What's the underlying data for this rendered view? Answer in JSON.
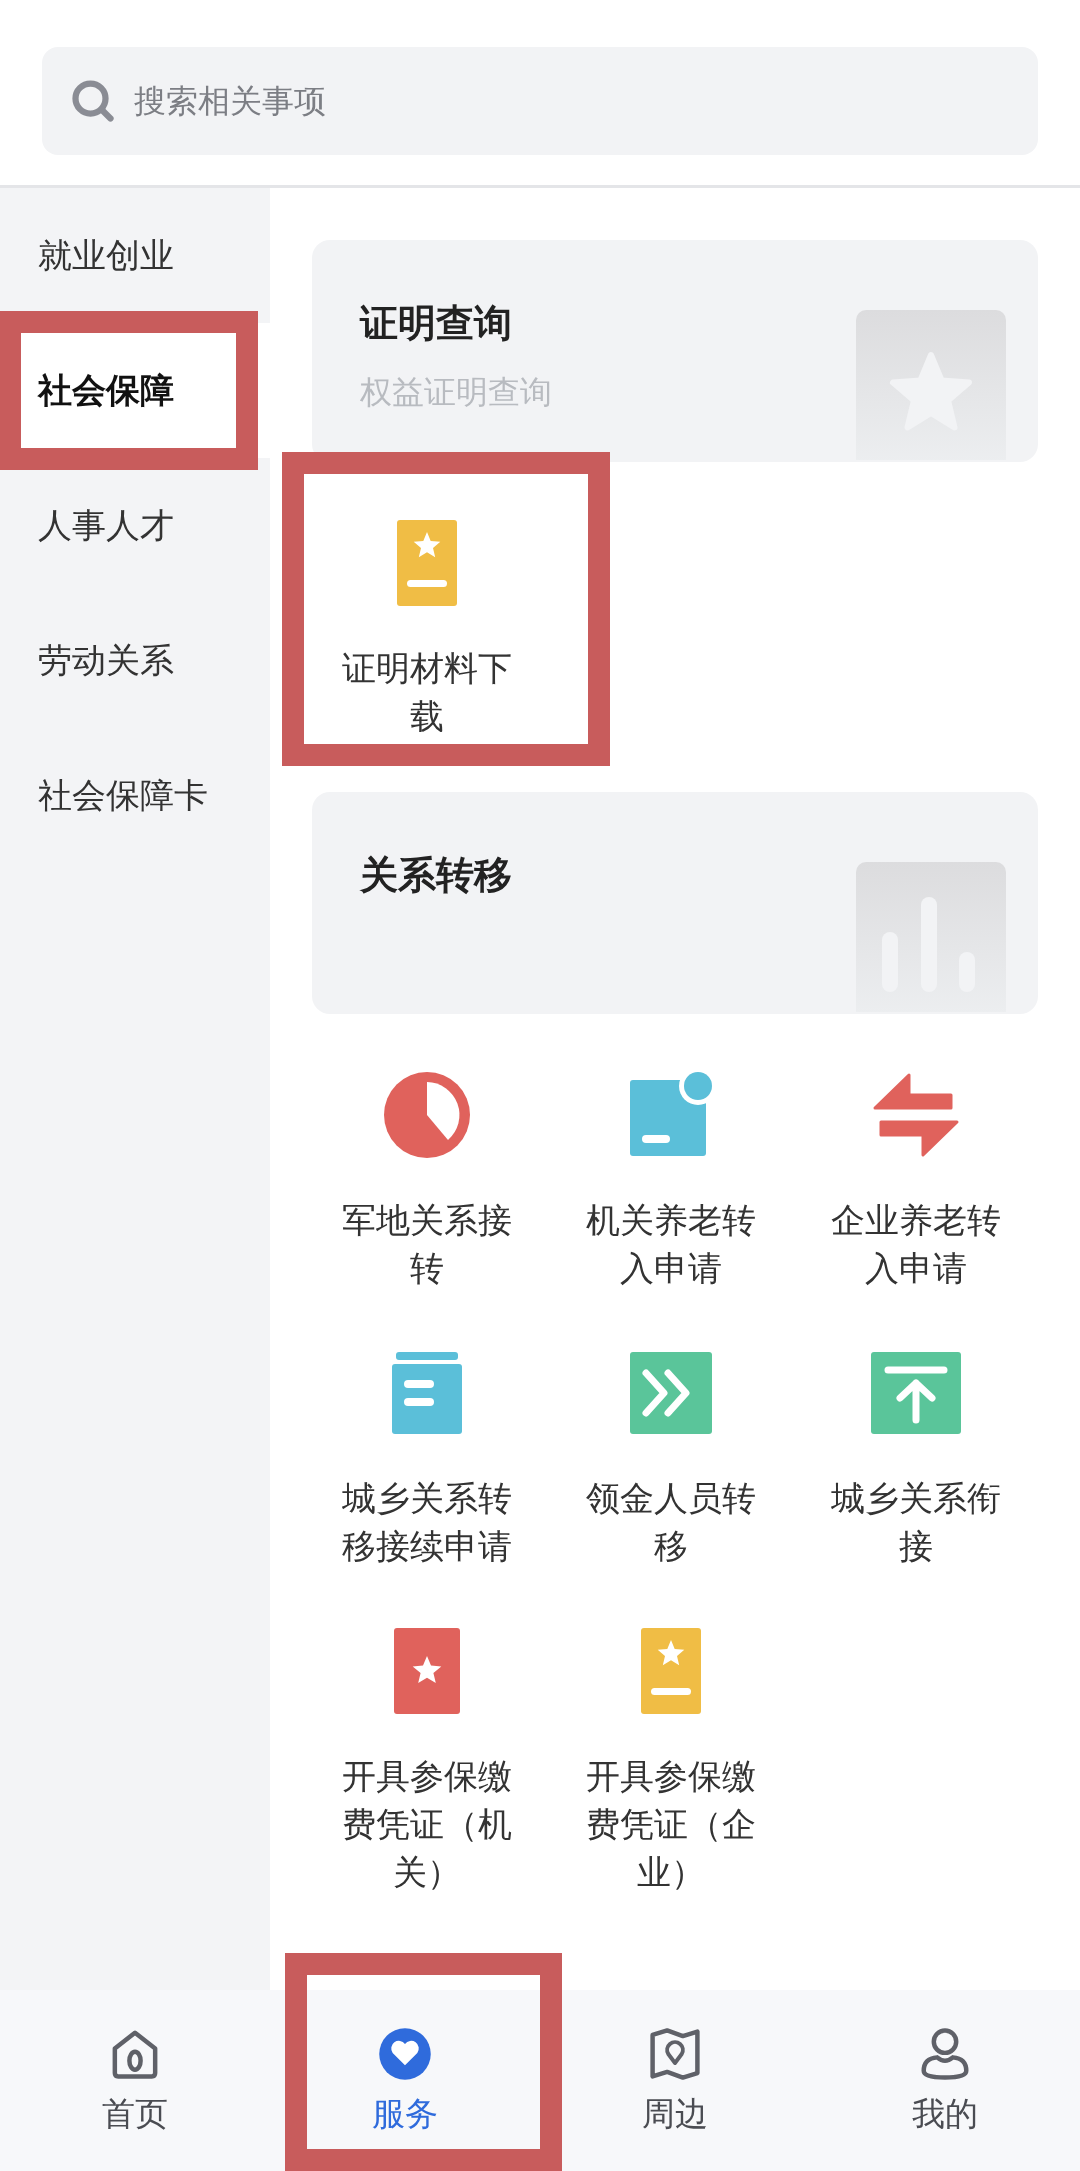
{
  "search": {
    "placeholder": "搜索相关事项"
  },
  "sidebar": {
    "items": [
      {
        "label": "就业创业",
        "selected": false,
        "highlighted": false
      },
      {
        "label": "社会保障",
        "selected": true,
        "highlighted": true
      },
      {
        "label": "人事人才",
        "selected": false,
        "highlighted": false
      },
      {
        "label": "劳动关系",
        "selected": false,
        "highlighted": false
      },
      {
        "label": "社会保障卡",
        "selected": false,
        "highlighted": false
      }
    ]
  },
  "sections": [
    {
      "title": "证明查询",
      "subtitle": "权益证明查询",
      "kind": "star",
      "items": [
        {
          "label": "证明材料下载",
          "kind": "star-card-bar",
          "color": "#f0bd45",
          "highlighted": true
        }
      ]
    },
    {
      "title": "关系转移",
      "kind": "bars",
      "items": [
        {
          "label": "军地关系接转",
          "kind": "pie",
          "color": "#e0625c",
          "highlighted": false
        },
        {
          "label": "机关养老转入申请",
          "kind": "dot-card",
          "color": "#5bbfd9",
          "highlighted": false
        },
        {
          "label": "企业养老转入申请",
          "kind": "swap",
          "color": "#e0625c",
          "highlighted": false
        },
        {
          "label": "城乡关系转移接续申请",
          "kind": "doc",
          "color": "#5bbfd9",
          "highlighted": false
        },
        {
          "label": "领金人员转移",
          "kind": "chevrons",
          "color": "#5ac59a",
          "highlighted": false
        },
        {
          "label": "城乡关系衔接",
          "kind": "top-arrow",
          "color": "#5ac59a",
          "highlighted": false
        },
        {
          "label": "开具参保缴费凭证（机关）",
          "kind": "star-card",
          "color": "#e0625c",
          "highlighted": false
        },
        {
          "label": "开具参保缴费凭证（企业）",
          "kind": "star-card-bar",
          "color": "#f0bd45",
          "highlighted": false
        }
      ]
    }
  ],
  "tab_bar": [
    {
      "label": "首页",
      "kind": "home",
      "selected": false,
      "highlighted": false
    },
    {
      "label": "服务",
      "kind": "heart",
      "selected": true,
      "highlighted": true
    },
    {
      "label": "周边",
      "kind": "map",
      "selected": false,
      "highlighted": false
    },
    {
      "label": "我的",
      "kind": "person",
      "selected": false,
      "highlighted": false
    }
  ]
}
